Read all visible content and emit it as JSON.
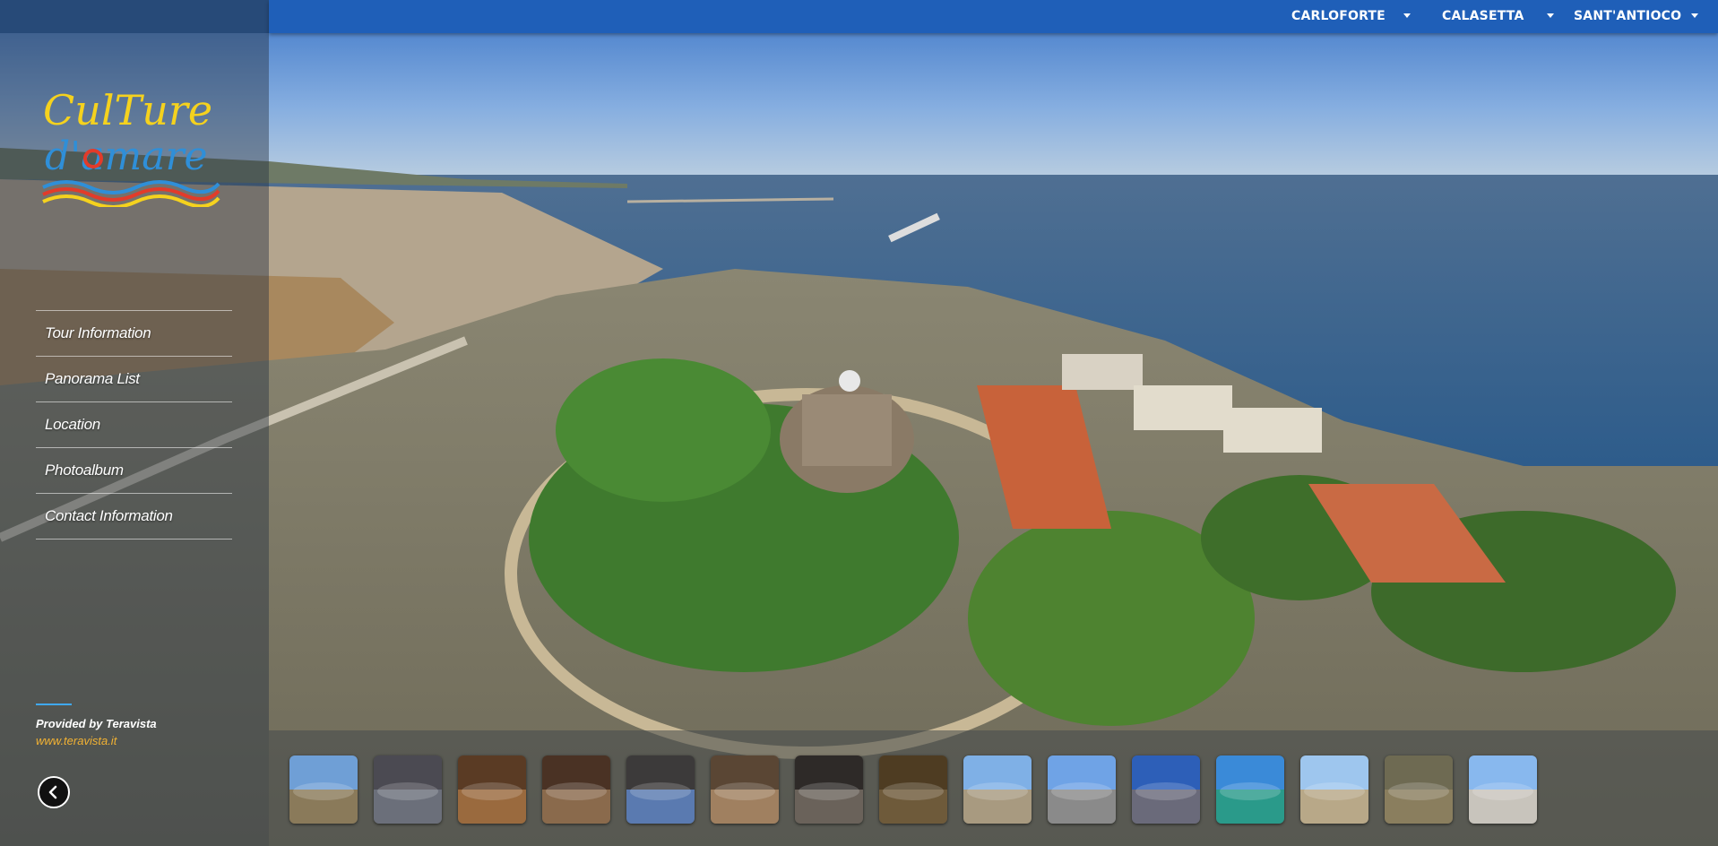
{
  "nav": {
    "items": [
      {
        "label": "CARLOFORTE"
      },
      {
        "label": "CALASETTA"
      },
      {
        "label": "SANT'ANTIOCO"
      }
    ]
  },
  "logo": {
    "line1": "CulTure",
    "line2": "d'amare"
  },
  "menu": {
    "items": [
      {
        "label": "Tour Information"
      },
      {
        "label": "Panorama List"
      },
      {
        "label": "Location"
      },
      {
        "label": "Photoalbum"
      },
      {
        "label": "Contact Information"
      }
    ]
  },
  "credit": {
    "label": "Provided by Teravista",
    "url": "www.teravista.it"
  },
  "thumbnails": [
    {
      "name": "thumb-aerial-fort",
      "sky": "#6f9fd6",
      "ground": "#8a7a5a"
    },
    {
      "name": "thumb-interior-stone",
      "sky": "#4b4a52",
      "ground": "#6b6f7a"
    },
    {
      "name": "thumb-interior-warm",
      "sky": "#5a3b24",
      "ground": "#9a6a3e"
    },
    {
      "name": "thumb-interior-vault",
      "sky": "#4a3224",
      "ground": "#8a6a4c"
    },
    {
      "name": "thumb-interior-blue",
      "sky": "#3c3a3a",
      "ground": "#5a7ab0"
    },
    {
      "name": "thumb-interior-arch",
      "sky": "#5a4634",
      "ground": "#a08060"
    },
    {
      "name": "thumb-interior-dark",
      "sky": "#2e2a28",
      "ground": "#6a625a"
    },
    {
      "name": "thumb-interior-brown",
      "sky": "#4e3c22",
      "ground": "#6e5a3a"
    },
    {
      "name": "thumb-terrace",
      "sky": "#7fb0e6",
      "ground": "#a89a80"
    },
    {
      "name": "thumb-town-view",
      "sky": "#6fa3e6",
      "ground": "#8a8a8a"
    },
    {
      "name": "thumb-tower-blue",
      "sky": "#2d5fb8",
      "ground": "#6a6a7a"
    },
    {
      "name": "thumb-coast",
      "sky": "#3a8ad8",
      "ground": "#2a9a8a"
    },
    {
      "name": "thumb-tower-white",
      "sky": "#9ec6ee",
      "ground": "#b8a888"
    },
    {
      "name": "thumb-field",
      "sky": "#6e6a52",
      "ground": "#8a7e5e"
    },
    {
      "name": "thumb-clouds",
      "sky": "#88b8ee",
      "ground": "#c8c4bc"
    }
  ],
  "colors": {
    "topbar": "#1f5fb8",
    "credit_url": "#f2b233",
    "logo_yellow": "#f5d21e",
    "logo_blue": "#2f8fd8"
  }
}
